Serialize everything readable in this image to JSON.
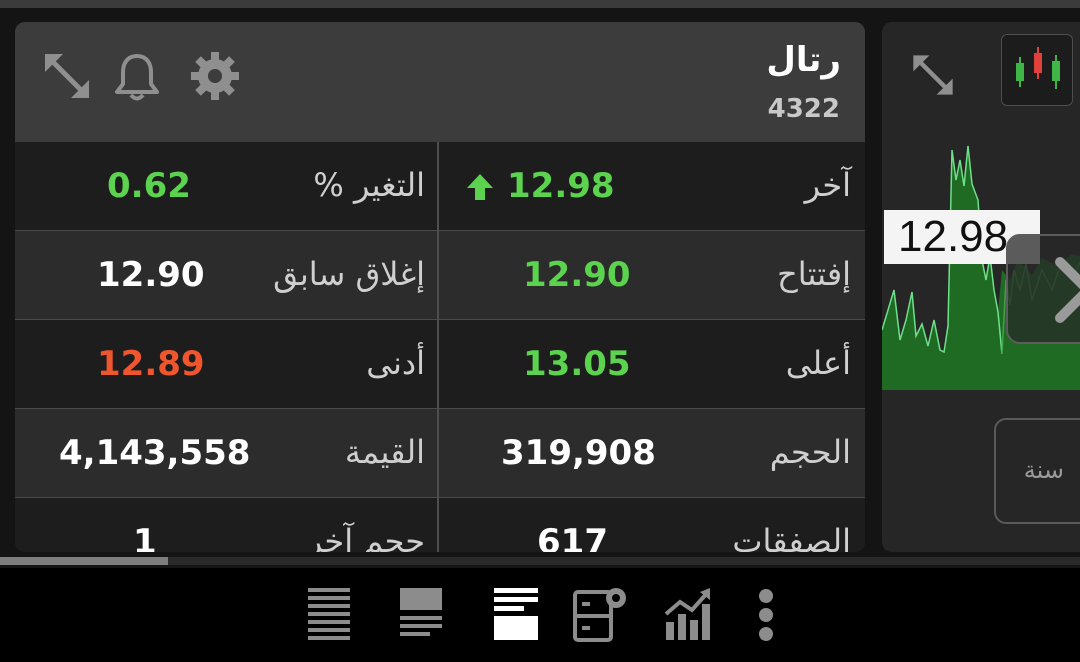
{
  "stock": {
    "name": "رتال",
    "code": "4322"
  },
  "header_icons": [
    "expand-icon",
    "bell-icon",
    "gear-icon"
  ],
  "stats": [
    {
      "label": "آخر",
      "value": "12.98",
      "arrow": "up"
    },
    {
      "label": "التغير %",
      "value": "0.62"
    },
    {
      "label": "إفتتاح",
      "value": "12.90"
    },
    {
      "label": "إغلاق سابق",
      "value": "12.90"
    },
    {
      "label": "أعلى",
      "value": "13.05"
    },
    {
      "label": "أدنى",
      "value": "12.89"
    },
    {
      "label": "الحجم",
      "value": "319,908"
    },
    {
      "label": "القيمة",
      "value": "4,143,558"
    },
    {
      "label": "الصفقات",
      "value": "617"
    },
    {
      "label": "حجم آخر",
      "value": "1"
    }
  ],
  "side": {
    "last_price": "12.98",
    "period_label": "سنة",
    "icons": [
      "expand-icon",
      "candlestick-icon",
      "chevron-right-icon"
    ]
  },
  "bottom_nav": [
    "list-dense-icon",
    "list-summary-icon",
    "list-detail-icon",
    "screener-settings-icon",
    "chart-growth-icon",
    "more-vertical-icon"
  ],
  "colors": {
    "up": "#5bd34f",
    "down": "#f0562e",
    "chart_fill": "#1f6b24",
    "chart_line": "#6fe08a"
  }
}
